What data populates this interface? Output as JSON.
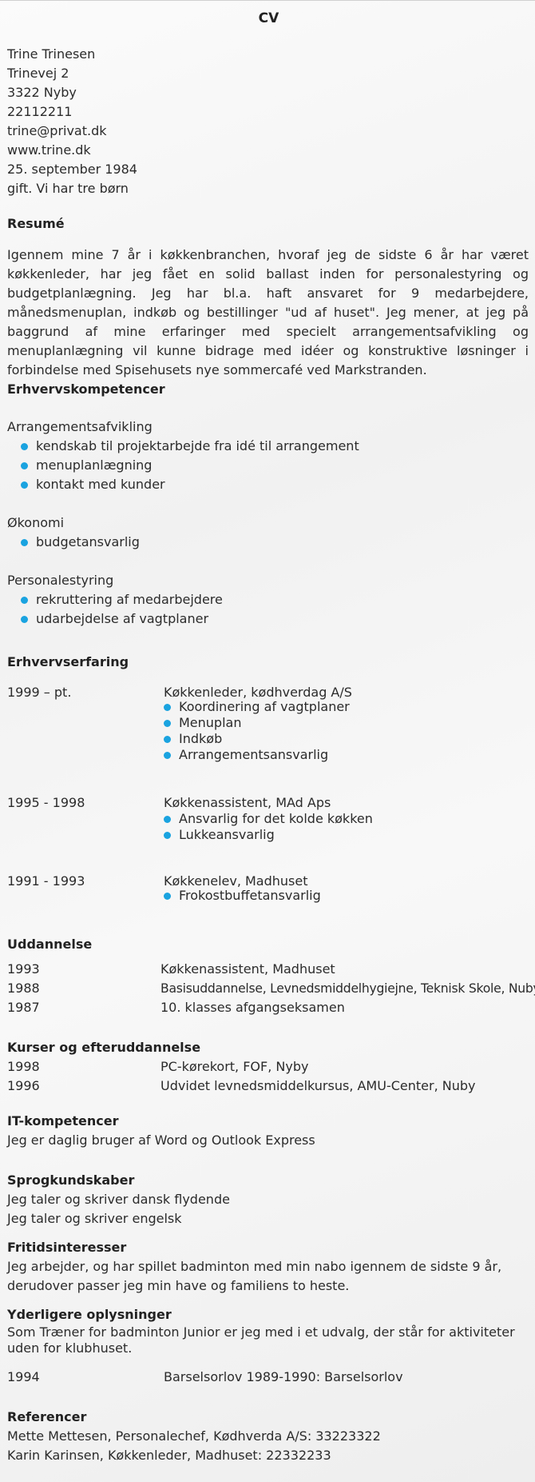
{
  "title": "CV",
  "contact": [
    "Trine Trinesen",
    "Trinevej 2",
    "3322 Nyby",
    "22112211",
    "trine@privat.dk",
    "www.trine.dk",
    "25. september 1984",
    "gift. Vi har tre børn"
  ],
  "resume": {
    "heading": "Resumé",
    "text": "Igennem mine 7 år i køkkenbranchen, hvoraf jeg de sidste 6 år har været køkkenleder, har jeg fået en solid ballast inden for personalestyring og budgetplanlægning. Jeg har bl.a. haft ansvaret for 9 medarbejdere, månedsmenuplan, indkøb og bestillinger \"ud af huset\". Jeg mener, at jeg på baggrund af mine erfaringer med specielt arrangementsaf­vikling og menuplanlægning vil kunne bidrage med idéer og konstruktive løsninger i forbindelse med Spisehusets nye sommercafé ved Markstranden."
  },
  "competences": {
    "heading": "Erhvervskompetencer",
    "groups": [
      {
        "title": "Arrangementsafvikling",
        "items": [
          "kendskab til projektarbejde fra idé til arrangement",
          "menuplanlægning",
          "kontakt med kunder"
        ]
      },
      {
        "title": "Økonomi",
        "items": [
          "budgetansvarlig"
        ]
      },
      {
        "title": "Personalestyring",
        "items": [
          "rekruttering af medarbejdere",
          "udarbejdelse af vagtplaner"
        ]
      }
    ]
  },
  "experience": {
    "heading": "Erhvervserfaring",
    "entries": [
      {
        "period": "1999 – pt.",
        "title": "Køkkenleder, kødhverdag A/S",
        "items": [
          "Koordinering af vagtplaner",
          "Menuplan",
          "Indkøb",
          "Arrangementsansvarlig"
        ]
      },
      {
        "period": "1995 - 1998",
        "title": "Køkkenassistent, MAd Aps",
        "items": [
          "Ansvarlig for det kolde køkken",
          "Lukkeansvarlig"
        ]
      },
      {
        "period": "1991 - 1993",
        "title": "Køkkenelev, Madhuset",
        "items": [
          "Frokostbuffetansvarlig"
        ]
      }
    ]
  },
  "education": {
    "heading": "Uddannelse",
    "rows": [
      {
        "year": "1993",
        "text": "Køkkenassistent, Madhuset"
      },
      {
        "year": "1988",
        "text": "Basisuddannelse, Levnedsmiddelhygiejne, Teknisk Skole, Nuby"
      },
      {
        "year": "1987",
        "text": "10. klasses afgangseksamen"
      }
    ]
  },
  "courses": {
    "heading": "Kurser og efteruddannelse",
    "rows": [
      {
        "year": "1998",
        "text": "PC-kørekort, FOF, Nyby"
      },
      {
        "year": "1996",
        "text": "Udvidet levnedsmiddelkursus, AMU-Center, Nuby"
      }
    ]
  },
  "it": {
    "heading": "IT-kompetencer",
    "text": "Jeg er daglig bruger af Word og Outlook Express"
  },
  "languages": {
    "heading": "Sprogkundskaber",
    "lines": [
      "Jeg taler og skriver dansk flydende",
      "Jeg taler og skriver engelsk"
    ]
  },
  "leisure": {
    "heading": "Fritidsinteresser",
    "lines": [
      "Jeg arbejder, og har spillet badminton med min nabo igennem de sidste 9 år,",
      "derudover passer jeg min have og familiens to heste."
    ]
  },
  "additional": {
    "heading": "Yderligere oplysninger",
    "lines": [
      "Som Træner for badminton Junior er jeg med i et udvalg, der står for aktiviteter",
      "uden for klubhuset."
    ],
    "year": "1994",
    "year_text": "Barselsorlov 1989-1990: Barselsorlov"
  },
  "references": {
    "heading": "Referencer",
    "lines": [
      "Mette Mettesen, Personalechef, Kødhverda A/S: 33223322",
      "Karin Karinsen, Køkkenleder, Madhuset: 22332233"
    ]
  },
  "colors": {
    "bullet": "#1aa3e0",
    "text": "#2b2b2b"
  }
}
